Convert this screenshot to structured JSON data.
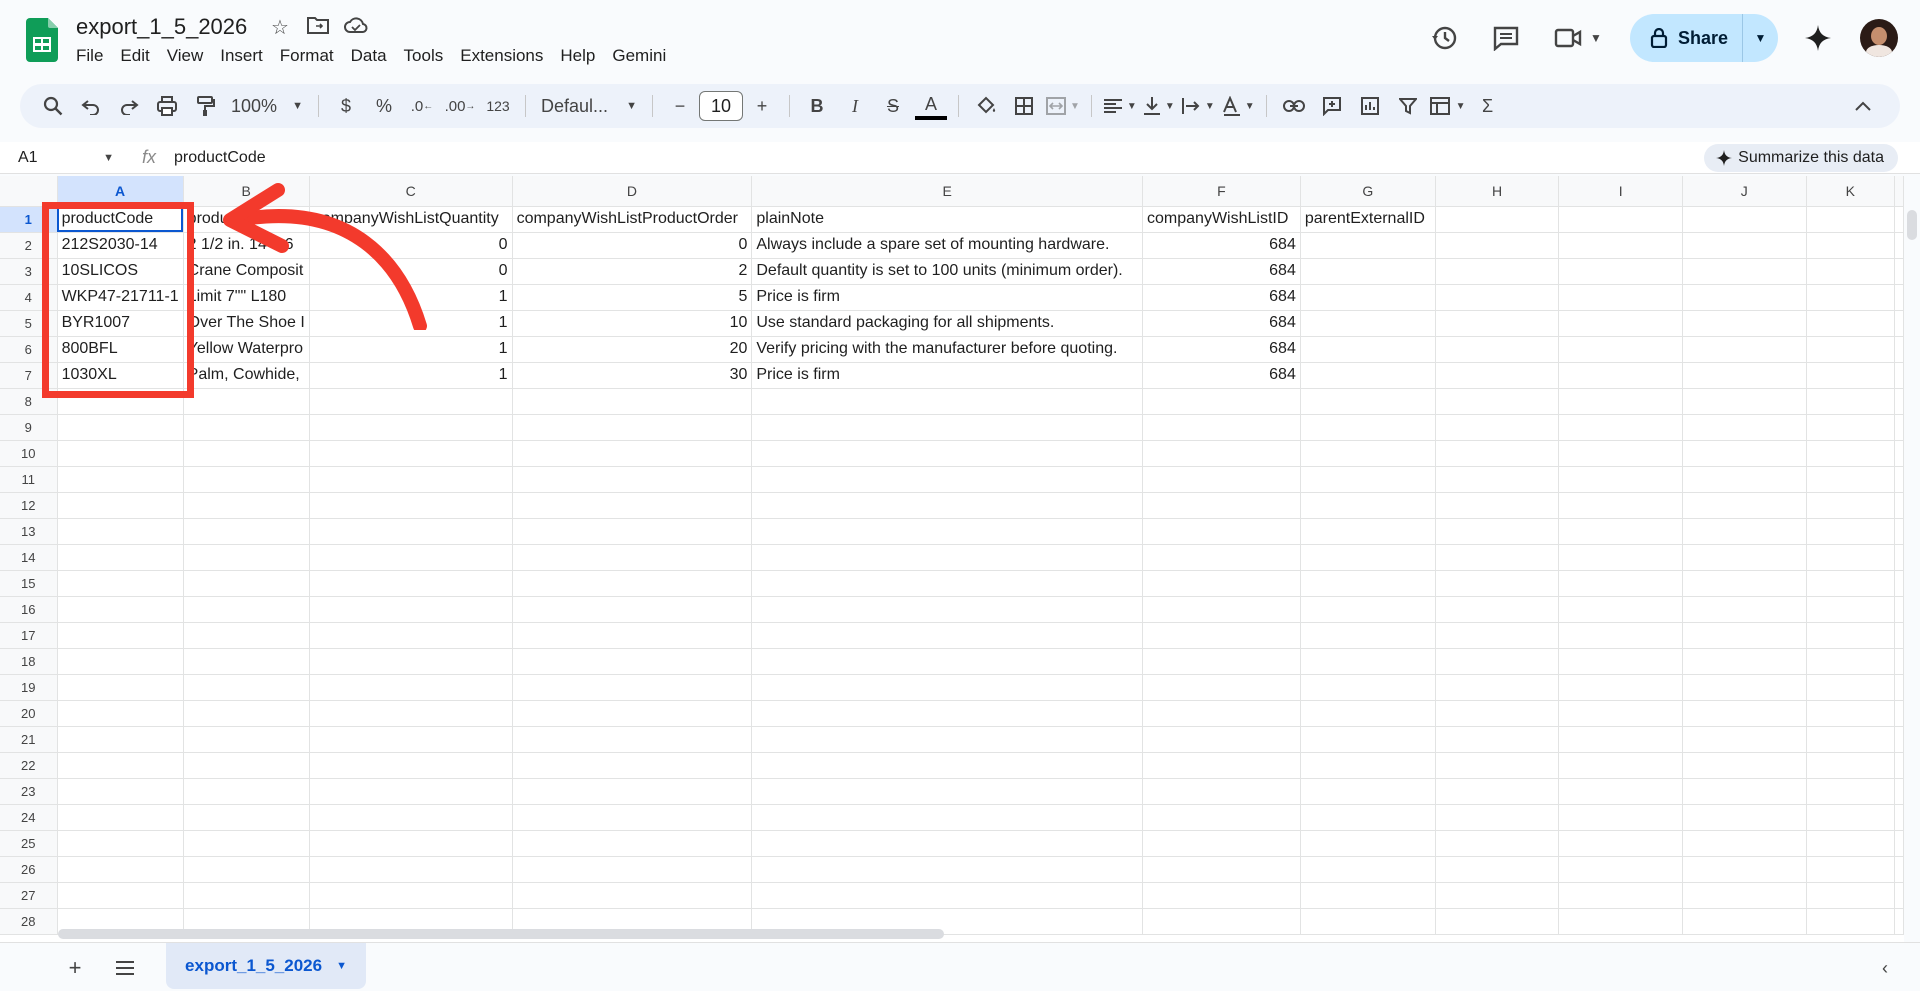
{
  "app": {
    "doc_title": "export_1_5_2026",
    "menu": [
      "File",
      "Edit",
      "View",
      "Insert",
      "Format",
      "Data",
      "Tools",
      "Extensions",
      "Help",
      "Gemini"
    ],
    "share_label": "Share",
    "colors": {
      "share_bg": "#c2e7ff",
      "accent": "#0b57d0",
      "annotation": "#f33a2c",
      "logo_green": "#0f9d58"
    }
  },
  "toolbar": {
    "zoom": "100%",
    "currency": "$",
    "percent": "%",
    "dec_decrease": ".0",
    "dec_increase": ".00",
    "format_123": "123",
    "font": "Defaul...",
    "font_size": "10",
    "minus": "−",
    "plus": "+",
    "bold": "B",
    "italic": "I",
    "strike": "S",
    "text_color": "A",
    "sum": "Σ"
  },
  "formula_bar": {
    "cell_ref": "A1",
    "fx": "fx",
    "content": "productCode",
    "summarize_label": "Summarize this data"
  },
  "sheet": {
    "columns": [
      "A",
      "B",
      "C",
      "D",
      "E",
      "F",
      "G",
      "H",
      "I",
      "J",
      "K"
    ],
    "selected_column": "A",
    "selected_row": "1",
    "rows": [
      {
        "n": "1",
        "cells": [
          "productCode",
          "productName",
          "companyWishListQuantity",
          "companyWishListProductOrder",
          "plainNote",
          "companyWishListID",
          "parentExternalID",
          "",
          "",
          "",
          ""
        ]
      },
      {
        "n": "2",
        "cells": [
          "212S2030-14",
          "2 1/2 in. 14 ft 6",
          "0",
          "0",
          "Always include a spare set of mounting hardware.",
          "684",
          "",
          "",
          "",
          "",
          ""
        ]
      },
      {
        "n": "3",
        "cells": [
          "10SLICOS",
          "Crane Composit",
          "0",
          "2",
          "Default quantity is set to 100 units (minimum order).",
          "684",
          "",
          "",
          "",
          "",
          ""
        ]
      },
      {
        "n": "4",
        "cells": [
          "WKP47-21711-1",
          "Limit 7\"\" L180",
          "1",
          "5",
          "Price is firm",
          "684",
          "",
          "",
          "",
          "",
          ""
        ]
      },
      {
        "n": "5",
        "cells": [
          "BYR1007",
          "Over The Shoe I",
          "1",
          "10",
          "Use standard packaging for all shipments.",
          "684",
          "",
          "",
          "",
          "",
          ""
        ]
      },
      {
        "n": "6",
        "cells": [
          "800BFL",
          "Yellow Waterpro",
          "1",
          "20",
          "Verify pricing with the manufacturer before quoting.",
          "684",
          "",
          "",
          "",
          "",
          ""
        ]
      },
      {
        "n": "7",
        "cells": [
          "1030XL",
          "Palm, Cowhide,",
          "1",
          "30",
          "Price is firm",
          "684",
          "",
          "",
          "",
          "",
          ""
        ]
      },
      {
        "n": "8",
        "cells": [
          "",
          "",
          "",
          "",
          "",
          "",
          "",
          "",
          "",
          "",
          ""
        ]
      },
      {
        "n": "9",
        "cells": [
          "",
          "",
          "",
          "",
          "",
          "",
          "",
          "",
          "",
          "",
          ""
        ]
      },
      {
        "n": "10",
        "cells": [
          "",
          "",
          "",
          "",
          "",
          "",
          "",
          "",
          "",
          "",
          ""
        ]
      },
      {
        "n": "11",
        "cells": [
          "",
          "",
          "",
          "",
          "",
          "",
          "",
          "",
          "",
          "",
          ""
        ]
      },
      {
        "n": "12",
        "cells": [
          "",
          "",
          "",
          "",
          "",
          "",
          "",
          "",
          "",
          "",
          ""
        ]
      },
      {
        "n": "13",
        "cells": [
          "",
          "",
          "",
          "",
          "",
          "",
          "",
          "",
          "",
          "",
          ""
        ]
      },
      {
        "n": "14",
        "cells": [
          "",
          "",
          "",
          "",
          "",
          "",
          "",
          "",
          "",
          "",
          ""
        ]
      },
      {
        "n": "15",
        "cells": [
          "",
          "",
          "",
          "",
          "",
          "",
          "",
          "",
          "",
          "",
          ""
        ]
      },
      {
        "n": "16",
        "cells": [
          "",
          "",
          "",
          "",
          "",
          "",
          "",
          "",
          "",
          "",
          ""
        ]
      },
      {
        "n": "17",
        "cells": [
          "",
          "",
          "",
          "",
          "",
          "",
          "",
          "",
          "",
          "",
          ""
        ]
      },
      {
        "n": "18",
        "cells": [
          "",
          "",
          "",
          "",
          "",
          "",
          "",
          "",
          "",
          "",
          ""
        ]
      },
      {
        "n": "19",
        "cells": [
          "",
          "",
          "",
          "",
          "",
          "",
          "",
          "",
          "",
          "",
          ""
        ]
      },
      {
        "n": "20",
        "cells": [
          "",
          "",
          "",
          "",
          "",
          "",
          "",
          "",
          "",
          "",
          ""
        ]
      },
      {
        "n": "21",
        "cells": [
          "",
          "",
          "",
          "",
          "",
          "",
          "",
          "",
          "",
          "",
          ""
        ]
      },
      {
        "n": "22",
        "cells": [
          "",
          "",
          "",
          "",
          "",
          "",
          "",
          "",
          "",
          "",
          ""
        ]
      },
      {
        "n": "23",
        "cells": [
          "",
          "",
          "",
          "",
          "",
          "",
          "",
          "",
          "",
          "",
          ""
        ]
      },
      {
        "n": "24",
        "cells": [
          "",
          "",
          "",
          "",
          "",
          "",
          "",
          "",
          "",
          "",
          ""
        ]
      },
      {
        "n": "25",
        "cells": [
          "",
          "",
          "",
          "",
          "",
          "",
          "",
          "",
          "",
          "",
          ""
        ]
      },
      {
        "n": "26",
        "cells": [
          "",
          "",
          "",
          "",
          "",
          "",
          "",
          "",
          "",
          "",
          ""
        ]
      },
      {
        "n": "27",
        "cells": [
          "",
          "",
          "",
          "",
          "",
          "",
          "",
          "",
          "",
          "",
          ""
        ]
      },
      {
        "n": "28",
        "cells": [
          "",
          "",
          "",
          "",
          "",
          "",
          "",
          "",
          "",
          "",
          ""
        ]
      }
    ],
    "numeric_columns": [
      2,
      3,
      5
    ]
  },
  "bottom": {
    "sheet_tab": "export_1_5_2026"
  }
}
